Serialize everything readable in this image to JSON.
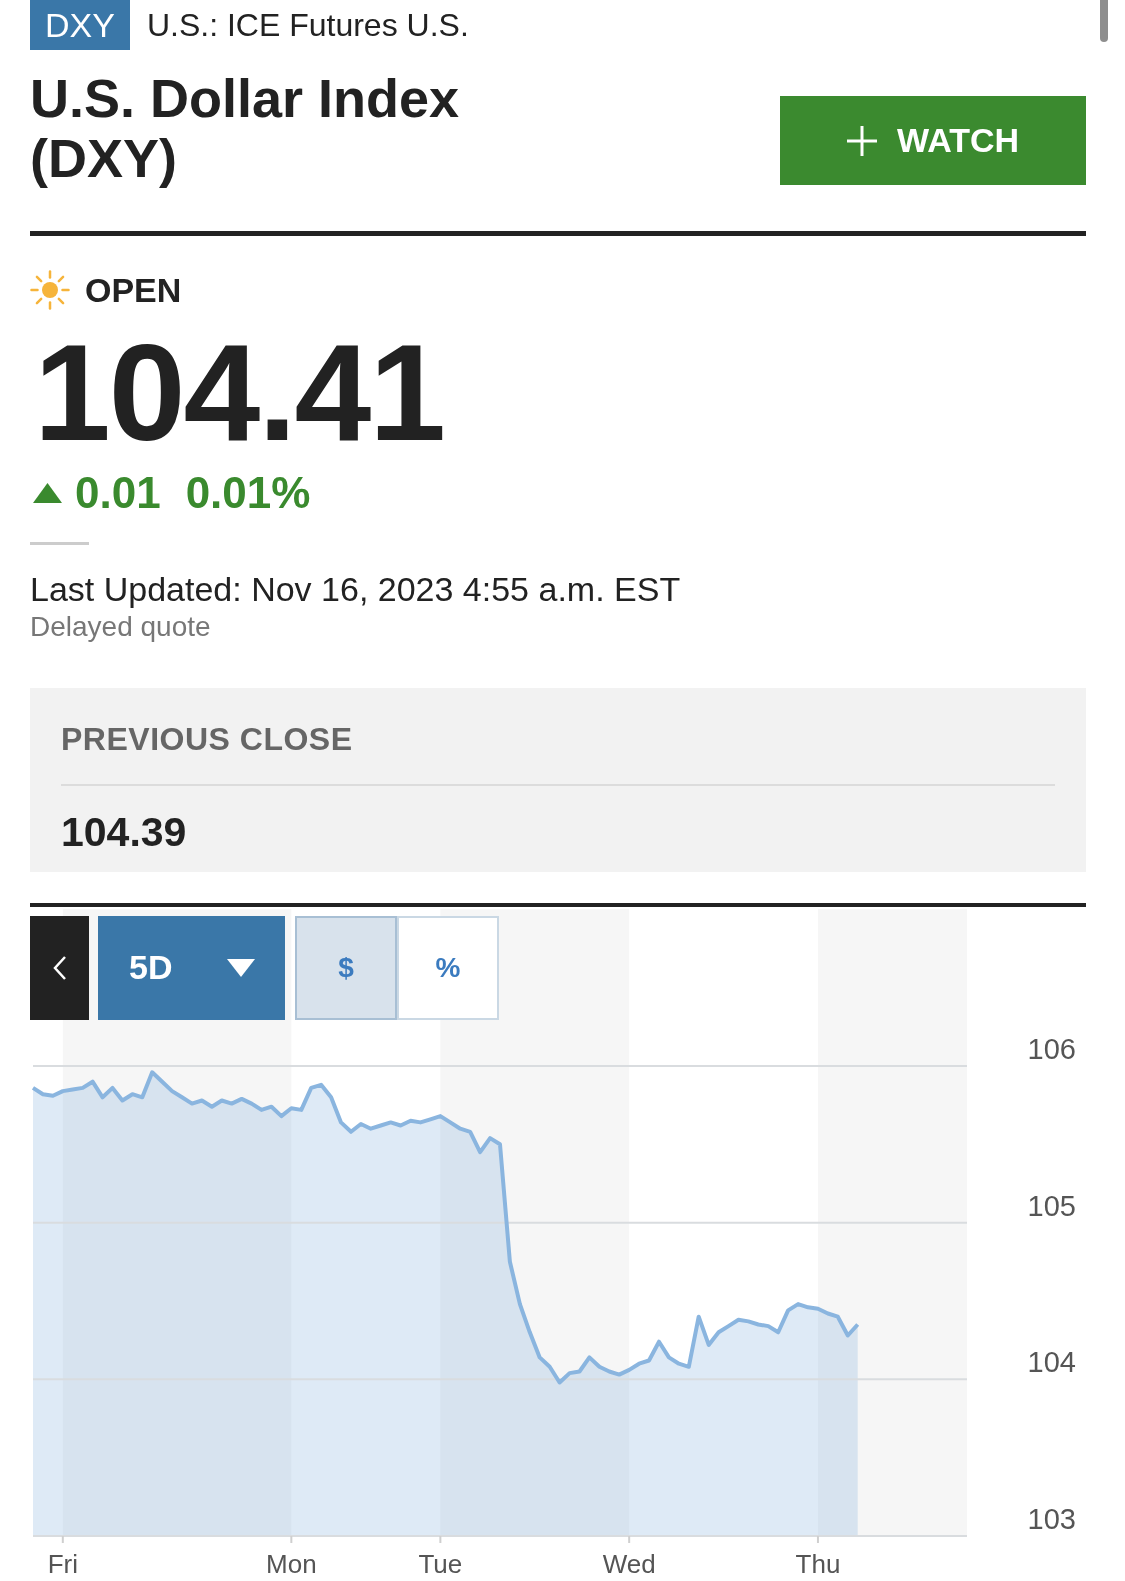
{
  "header": {
    "ticker": "DXY",
    "exchange": "U.S.: ICE Futures U.S."
  },
  "title": "U.S. Dollar Index (DXY)",
  "watch_button": {
    "label": "WATCH"
  },
  "market_status": {
    "label": "OPEN"
  },
  "quote": {
    "price": "104.41",
    "rising": true,
    "change": "0.01",
    "change_percent": "0.01%",
    "last_updated": "Last Updated: Nov 16, 2023 4:55 a.m. EST",
    "delay_note": "Delayed quote"
  },
  "previous_close": {
    "label": "PREVIOUS CLOSE",
    "value": "104.39"
  },
  "chart": {
    "range": {
      "label": "5D"
    },
    "units": [
      {
        "label": "$",
        "selected": true
      },
      {
        "label": "%",
        "selected": false
      }
    ],
    "chart_data": {
      "type": "area",
      "grid": true,
      "categories": [
        null,
        null,
        null,
        "Fri",
        null,
        null,
        null,
        null,
        null,
        null,
        null,
        null,
        null,
        null,
        null,
        null,
        null,
        null,
        null,
        null,
        null,
        null,
        null,
        null,
        null,
        null,
        "Mon",
        null,
        null,
        null,
        null,
        null,
        null,
        null,
        null,
        null,
        null,
        null,
        null,
        null,
        null,
        "Tue",
        null,
        null,
        null,
        null,
        null,
        null,
        null,
        null,
        null,
        null,
        null,
        null,
        null,
        null,
        null,
        null,
        null,
        null,
        "Wed",
        null,
        null,
        null,
        null,
        null,
        null,
        null,
        null,
        null,
        null,
        null,
        null,
        null,
        null,
        null,
        null,
        null,
        null,
        "Thu",
        null,
        null,
        null,
        null,
        null,
        null,
        null,
        null,
        null,
        null,
        null,
        null,
        null,
        null
      ],
      "series": [
        {
          "color": "#8ab5df",
          "values": [
            105.86,
            105.82,
            105.81,
            105.84,
            105.85,
            105.86,
            105.9,
            105.8,
            105.86,
            105.78,
            105.82,
            105.8,
            105.96,
            105.9,
            105.84,
            105.8,
            105.76,
            105.78,
            105.74,
            105.78,
            105.76,
            105.79,
            105.76,
            105.72,
            105.74,
            105.68,
            105.73,
            105.72,
            105.86,
            105.88,
            105.8,
            105.64,
            105.58,
            105.63,
            105.6,
            105.62,
            105.64,
            105.62,
            105.65,
            105.64,
            105.66,
            105.68,
            105.64,
            105.6,
            105.58,
            105.45,
            105.54,
            105.5,
            104.75,
            104.48,
            104.3,
            104.14,
            104.08,
            103.98,
            104.04,
            104.05,
            104.14,
            104.08,
            104.05,
            104.03,
            104.06,
            104.1,
            104.12,
            104.24,
            104.14,
            104.1,
            104.08,
            104.4,
            104.22,
            104.3,
            104.34,
            104.38,
            104.37,
            104.35,
            104.34,
            104.3,
            104.44,
            104.48,
            104.46,
            104.45,
            104.42,
            104.4,
            104.28,
            104.35,
            null,
            null,
            null,
            null,
            null,
            null,
            null,
            null,
            null,
            null
          ]
        }
      ],
      "ylim": [
        103,
        106
      ],
      "yticks": [
        103,
        104,
        105,
        106
      ]
    }
  }
}
